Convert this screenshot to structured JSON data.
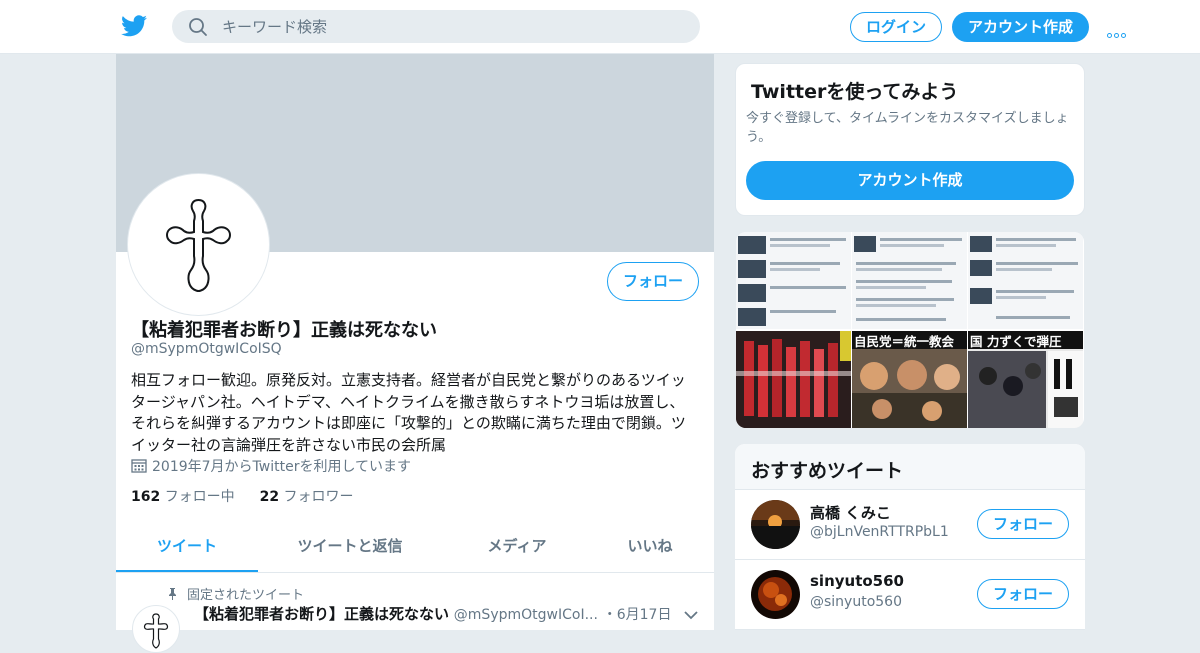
{
  "topbar": {
    "search_placeholder": "キーワード検索",
    "login_label": "ログイン",
    "signup_label": "アカウント作成",
    "brand_color": "#1da1f2"
  },
  "profile": {
    "follow_label": "フォロー",
    "name": "【粘着犯罪者お断り】正義は死なない",
    "handle": "@mSypmOtgwICoISQ",
    "bio": "相互フォロー歓迎。原発反対。立憲支持者。経営者が自民党と繋がりのあるツイッタージャパン社。ヘイトデマ、ヘイトクライムを撒き散らすネトウヨ垢は放置し、それらを糾弾するアカウントは即座に「攻撃的」との欺瞞に満ちた理由で閉鎖。ツイッター社の言論弾圧を許さない市民の会所属",
    "joined": "2019年7月からTwitterを利用しています",
    "following_count": "162",
    "following_label": "フォロー中",
    "followers_count": "22",
    "followers_label": "フォロワー"
  },
  "tabs": [
    {
      "label": "ツイート"
    },
    {
      "label": "ツイートと返信"
    },
    {
      "label": "メディア"
    },
    {
      "label": "いいね"
    }
  ],
  "pinned_tweet": {
    "pinned_label": "固定されたツイート",
    "author_name": "【粘着犯罪者お断り】正義は死なない",
    "author_handle": "@mSypmOtgwICoI...",
    "date": "・6月17日"
  },
  "signup_card": {
    "title": "Twitterを使ってみよう",
    "description": "今すぐ登録して、タイムラインをカスタマイズしましょう。",
    "button_label": "アカウント作成"
  },
  "media": {
    "banner_texts": [
      "自民党＝統一教会",
      "国 力ずくで弾圧"
    ]
  },
  "recommended": {
    "title": "おすすめツイート",
    "follow_label": "フォロー",
    "accounts": [
      {
        "name": "高橋 くみこ",
        "handle": "@bjLnVenRTTRPbL1"
      },
      {
        "name": "sinyuto560",
        "handle": "@sinyuto560"
      }
    ]
  }
}
